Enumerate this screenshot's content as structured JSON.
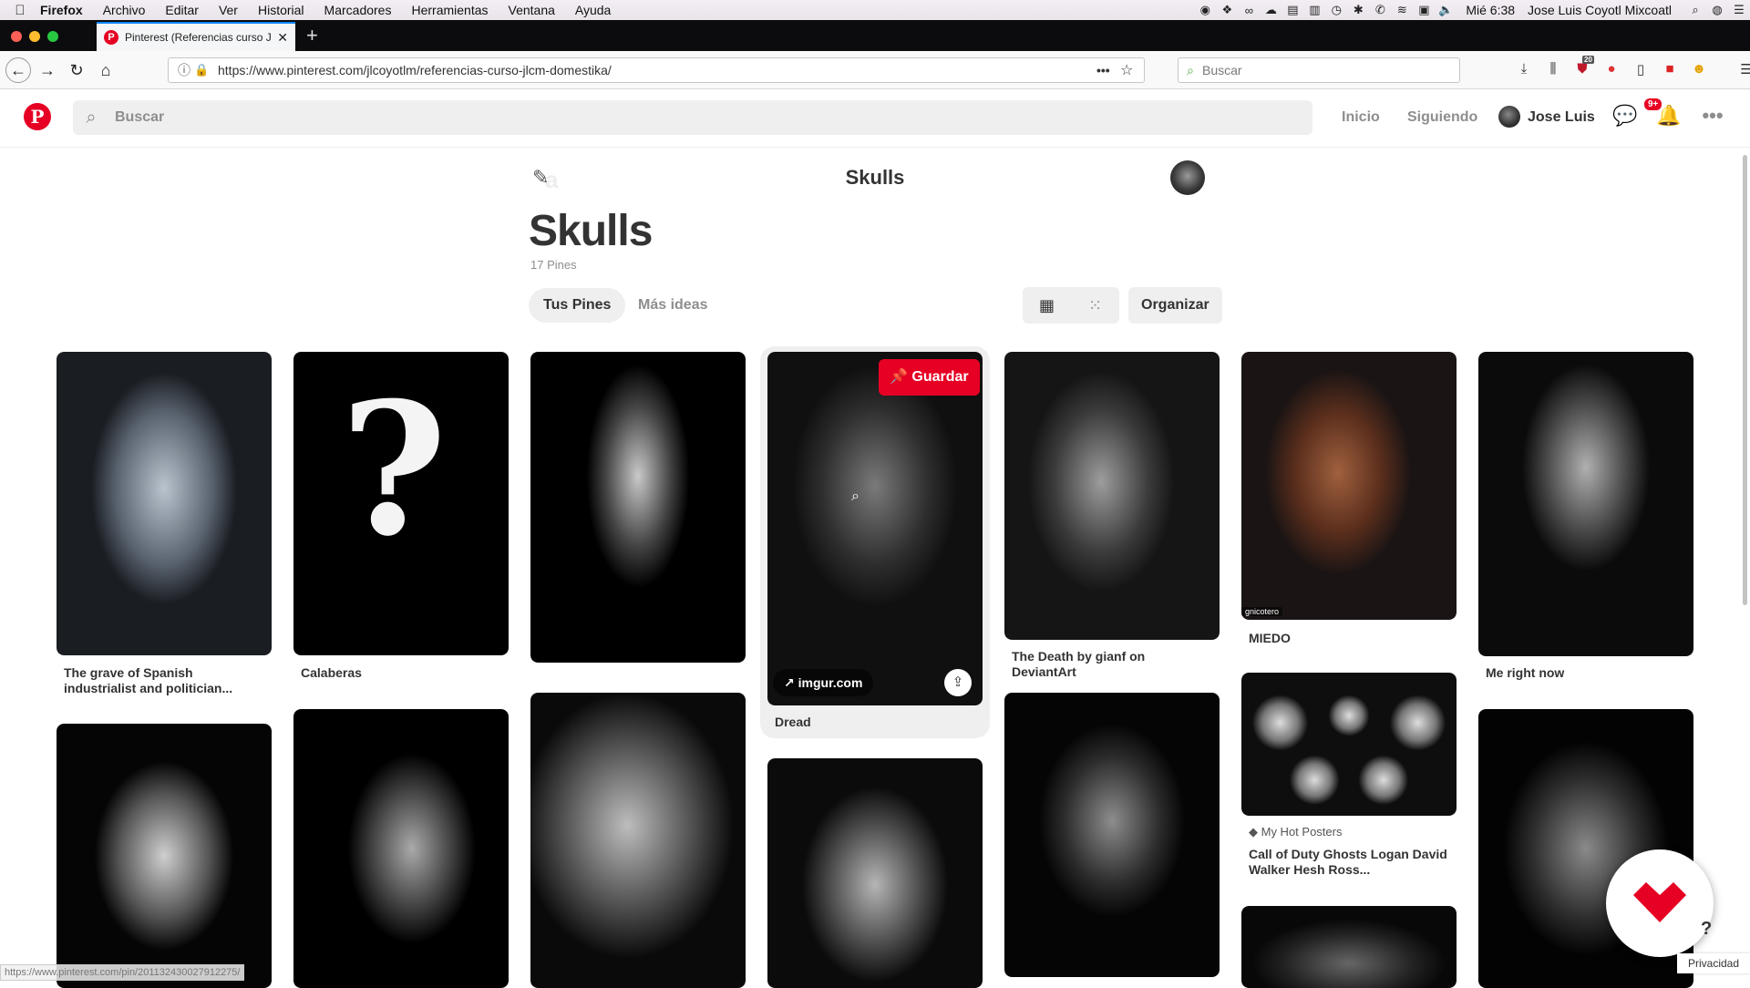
{
  "menubar": {
    "app": "Firefox",
    "items": [
      "Archivo",
      "Editar",
      "Ver",
      "Historial",
      "Marcadores",
      "Herramientas",
      "Ventana",
      "Ayuda"
    ],
    "clock": "Mié 6:38",
    "user": "Jose Luis Coyotl Mixcoatl"
  },
  "browser": {
    "tab_title": "Pinterest (Referencias curso JL",
    "url": "https://www.pinterest.com/jlcoyotlm/referencias-curso-jlcm-domestika/",
    "search_placeholder": "Buscar",
    "tool_badge": "20"
  },
  "pinterest": {
    "logo": "P",
    "search_placeholder": "Buscar",
    "nav_home": "Inicio",
    "nav_following": "Siguiendo",
    "user_name": "Jose Luis",
    "notif_badge": "9+"
  },
  "board": {
    "sticky_title": "Skulls",
    "title": "Skulls",
    "pin_count": "17 Pines",
    "tab_your_pins": "Tus Pines",
    "tab_more_ideas": "Más ideas",
    "organize": "Organizar"
  },
  "pins": {
    "p1": "The grave of Spanish industrialist and politician...",
    "p2": "Calaberas",
    "p4": "Dread",
    "p5": "The Death by gianf on DeviantArt",
    "p6": "MIEDO",
    "p6_credit": "gnicotero",
    "p7": "Me right now",
    "p13_source": "My Hot Posters",
    "p13": "Call of Duty Ghosts Logan David Walker Hesh Ross...",
    "save_label": "Guardar",
    "domain_label": "imgur.com"
  },
  "status_url": "https://www.pinterest.com/pin/201132430027912275/",
  "privacy_label": "Privacidad",
  "help_label": "?"
}
